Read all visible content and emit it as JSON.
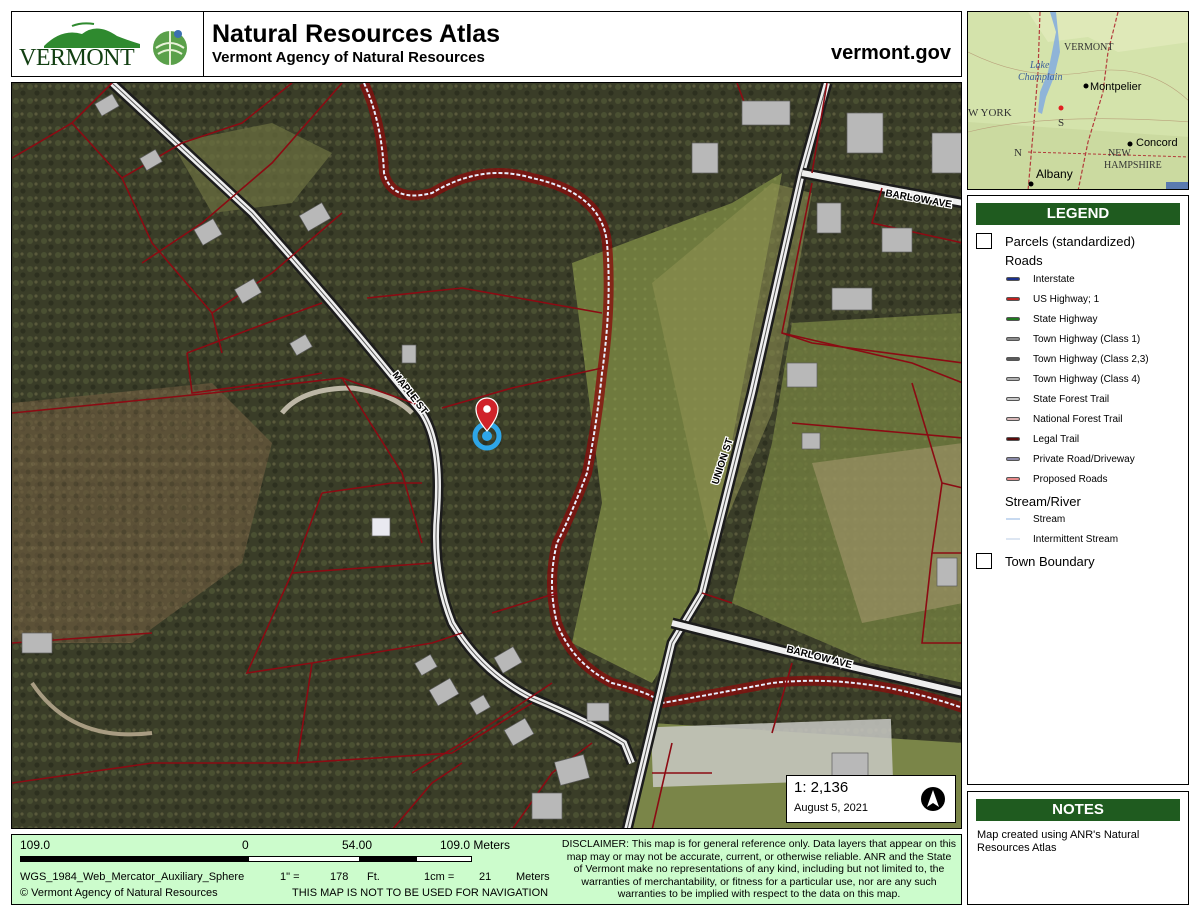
{
  "header": {
    "logo_text": "VERMONT",
    "title": "Natural Resources Atlas",
    "subtitle": "Vermont Agency of Natural Resources",
    "site": "vermont.gov"
  },
  "map": {
    "street_labels": {
      "maple": "MAPLE ST",
      "union": "UNION ST",
      "barlow_top": "BARLOW AVE",
      "barlow_bottom": "BARLOW AVE"
    },
    "scale": "1:  2,136",
    "date": "August 5, 2021"
  },
  "inset": {
    "labels": {
      "vermont": "VERMONT",
      "lake": "Lake",
      "champlain": "Champlain",
      "montpelier": "Montpelier",
      "new_york": "W YORK",
      "concord": "Concord",
      "new": "NEW",
      "hampshire": "HAMPSHIRE",
      "albany": "Albany",
      "s": "S",
      "n": "N"
    }
  },
  "legend": {
    "title": "LEGEND",
    "parcels": "Parcels (standardized)",
    "roads_heading": "Roads",
    "roads": [
      {
        "label": "Interstate",
        "color": "#1a2f8c"
      },
      {
        "label": "US Highway; 1",
        "color": "#c0201e"
      },
      {
        "label": "State Highway",
        "color": "#1f7a1f"
      },
      {
        "label": "Town Highway (Class 1)",
        "color": "#8a8a8a"
      },
      {
        "label": "Town Highway (Class 2,3)",
        "color": "#5a5a5a"
      },
      {
        "label": "Town Highway (Class 4)",
        "color": "#b0b0b0"
      },
      {
        "label": "State Forest Trail",
        "color": "#c8c8c8"
      },
      {
        "label": "National Forest Trail",
        "color": "#d8b8b8"
      },
      {
        "label": "Legal Trail",
        "color": "#5a0b0b"
      },
      {
        "label": "Private Road/Driveway",
        "color": "#8a8aa8"
      },
      {
        "label": "Proposed Roads",
        "color": "#e88a8a"
      }
    ],
    "stream_heading": "Stream/River",
    "streams": [
      {
        "label": "Stream",
        "color": "#c7d9f0"
      },
      {
        "label": "Intermittent Stream",
        "color": "#dde6f2"
      }
    ],
    "town_boundary": "Town Boundary"
  },
  "notes": {
    "title": "NOTES",
    "text": "Map created using ANR's Natural Resources Atlas"
  },
  "footer": {
    "scale_left": "109.0",
    "scale_zero": "0",
    "scale_mid": "54.00",
    "scale_right": "109.0 Meters",
    "projection": "WGS_1984_Web_Mercator_Auxiliary_Sphere",
    "inch_label": "1\" =",
    "inch_value": "178",
    "inch_unit": "Ft.",
    "cm_label": "1cm =",
    "cm_value": "21",
    "cm_unit": "Meters",
    "copyright": "© Vermont Agency of Natural Resources",
    "nav_warning": "THIS MAP IS NOT TO BE USED FOR NAVIGATION",
    "disclaimer": "DISCLAIMER: This map is for general reference only. Data layers that appear on this map may or may not be accurate, current, or otherwise reliable. ANR and the State of Vermont make no representations of any kind, including but not limited to, the warranties of merchantability, or fitness for a particular use, nor are any such warranties to be implied with respect to the data on this map."
  }
}
